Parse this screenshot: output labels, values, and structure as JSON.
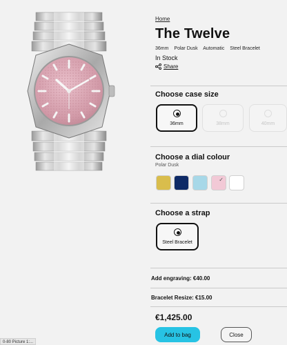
{
  "breadcrumb": "Home",
  "product": {
    "title": "The Twelve",
    "specs": [
      "36mm",
      "Polar Dusk",
      "Automatic",
      "Steel Bracelet"
    ],
    "stock": "In Stock",
    "share_label": "Share"
  },
  "case_size": {
    "heading": "Choose case size",
    "options": [
      {
        "label": "36mm",
        "selected": true
      },
      {
        "label": "38mm",
        "selected": false
      },
      {
        "label": "40mm",
        "selected": false
      }
    ]
  },
  "dial": {
    "heading": "Choose a dial colour",
    "selected_name": "Polar Dusk",
    "swatches": [
      {
        "color": "#d9bd4c",
        "selected": false
      },
      {
        "color": "#0e2a66",
        "selected": false
      },
      {
        "color": "#a7d8e8",
        "selected": false
      },
      {
        "color": "#f2c9d6",
        "selected": true
      },
      {
        "color": "#ffffff",
        "selected": false
      }
    ]
  },
  "strap": {
    "heading": "Choose a strap",
    "options": [
      {
        "label": "Steel Bracelet",
        "selected": true
      }
    ]
  },
  "addons": {
    "engraving": "Add engraving:  €40.00",
    "bracelet_resize": "Bracelet Resize:  €15.00"
  },
  "price": "€1,425.00",
  "buttons": {
    "add_to_bag": "Add to bag",
    "close": "Close"
  },
  "footer_tag": "0-80 Picture 1:..."
}
